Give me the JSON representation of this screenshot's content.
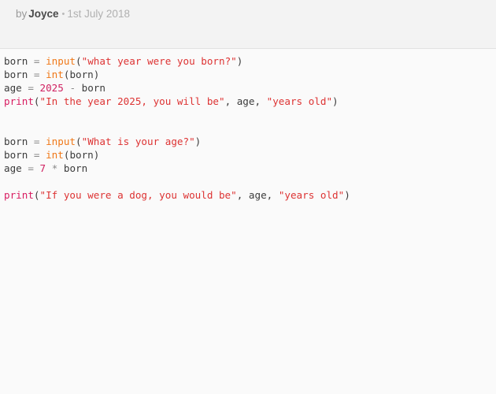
{
  "byline": {
    "by_label": "by",
    "author": "Joyce",
    "separator": "•",
    "date": "1st July 2018"
  },
  "colors": {
    "header_background": "#f3f3f3",
    "code_background": "#fafafa",
    "divider": "#e2e2e2",
    "text_plain": "#3b3b3b",
    "token_builtin": "#f07818",
    "token_string": "#dd3333",
    "token_number": "#d02060",
    "token_function": "#d81b60",
    "token_operator": "#8a8a8a",
    "author_text": "#4a4a4a",
    "muted_text": "#b0b0b0"
  },
  "code": {
    "language": "python",
    "lines": [
      [
        {
          "t": "born ",
          "c": "plain"
        },
        {
          "t": "= ",
          "c": "op"
        },
        {
          "t": "input",
          "c": "builtin"
        },
        {
          "t": "(",
          "c": "punct"
        },
        {
          "t": "\"what year were you born?\"",
          "c": "string"
        },
        {
          "t": ")",
          "c": "punct"
        }
      ],
      [
        {
          "t": "born ",
          "c": "plain"
        },
        {
          "t": "= ",
          "c": "op"
        },
        {
          "t": "int",
          "c": "builtin"
        },
        {
          "t": "(",
          "c": "punct"
        },
        {
          "t": "born",
          "c": "plain"
        },
        {
          "t": ")",
          "c": "punct"
        }
      ],
      [
        {
          "t": "age ",
          "c": "plain"
        },
        {
          "t": "= ",
          "c": "op"
        },
        {
          "t": "2025",
          "c": "number"
        },
        {
          "t": " - ",
          "c": "op"
        },
        {
          "t": "born",
          "c": "plain"
        }
      ],
      [
        {
          "t": "print",
          "c": "func"
        },
        {
          "t": "(",
          "c": "punct"
        },
        {
          "t": "\"In the year 2025, you will be\"",
          "c": "string"
        },
        {
          "t": ", age, ",
          "c": "plain"
        },
        {
          "t": "\"years old\"",
          "c": "string"
        },
        {
          "t": ")",
          "c": "punct"
        }
      ],
      [],
      [],
      [
        {
          "t": "born ",
          "c": "plain"
        },
        {
          "t": "= ",
          "c": "op"
        },
        {
          "t": "input",
          "c": "builtin"
        },
        {
          "t": "(",
          "c": "punct"
        },
        {
          "t": "\"What is your age?\"",
          "c": "string"
        },
        {
          "t": ")",
          "c": "punct"
        }
      ],
      [
        {
          "t": "born ",
          "c": "plain"
        },
        {
          "t": "= ",
          "c": "op"
        },
        {
          "t": "int",
          "c": "builtin"
        },
        {
          "t": "(",
          "c": "punct"
        },
        {
          "t": "born",
          "c": "plain"
        },
        {
          "t": ")",
          "c": "punct"
        }
      ],
      [
        {
          "t": "age ",
          "c": "plain"
        },
        {
          "t": "= ",
          "c": "op"
        },
        {
          "t": "7",
          "c": "number"
        },
        {
          "t": " ",
          "c": "plain"
        },
        {
          "t": "*",
          "c": "op"
        },
        {
          "t": " born",
          "c": "plain"
        }
      ],
      [],
      [
        {
          "t": "print",
          "c": "func"
        },
        {
          "t": "(",
          "c": "punct"
        },
        {
          "t": "\"If you were a dog, you would be\"",
          "c": "string"
        },
        {
          "t": ", age, ",
          "c": "plain"
        },
        {
          "t": "\"years old\"",
          "c": "string"
        },
        {
          "t": ")",
          "c": "punct"
        }
      ]
    ]
  }
}
